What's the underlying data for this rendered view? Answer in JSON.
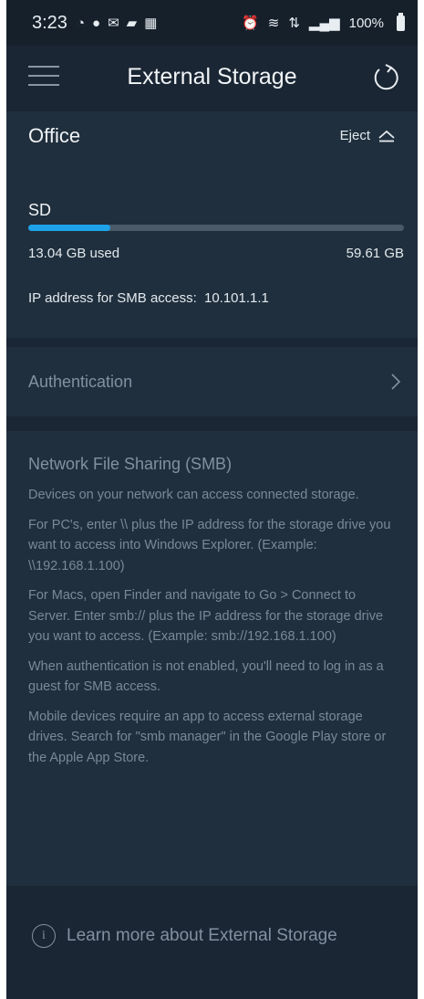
{
  "status_bar": {
    "time": "3:23",
    "left_icons": [
      "ring-icon",
      "alarm-sound-icon",
      "mail-icon",
      "chat-icon",
      "calendar-icon"
    ],
    "right_icons": [
      "alarm-icon",
      "wifi-icon",
      "lte-icon",
      "signal-icon"
    ],
    "battery": "100%"
  },
  "appbar": {
    "title": "External Storage"
  },
  "office": {
    "name": "Office",
    "eject_label": "Eject",
    "drive_label": "SD",
    "used_fraction": 0.219,
    "used_label": "13.04 GB used",
    "total_label": "59.61 GB",
    "ip_label": "IP address for SMB access:",
    "ip_value": "10.101.1.1",
    "accent": "#1ea2e8"
  },
  "auth": {
    "label": "Authentication"
  },
  "smb": {
    "title": "Network File Sharing (SMB)",
    "paragraphs": [
      "Devices on your network can access connected storage.",
      "For PC's, enter \\\\ plus the IP address for the storage drive you want to access into Windows Explorer. (Example: \\\\192.168.1.100)",
      "For Macs, open Finder and navigate to Go > Connect to Server. Enter smb:// plus the IP address for the storage drive you want to access. (Example: smb://192.168.1.100)",
      "When authentication is not enabled, you'll need to log in as a guest for SMB access.",
      "Mobile devices require an app to access external storage drives. Search for \"smb manager\" in the Google Play store or the Apple App Store."
    ]
  },
  "footer": {
    "learn_more": "Learn more about External Storage"
  }
}
